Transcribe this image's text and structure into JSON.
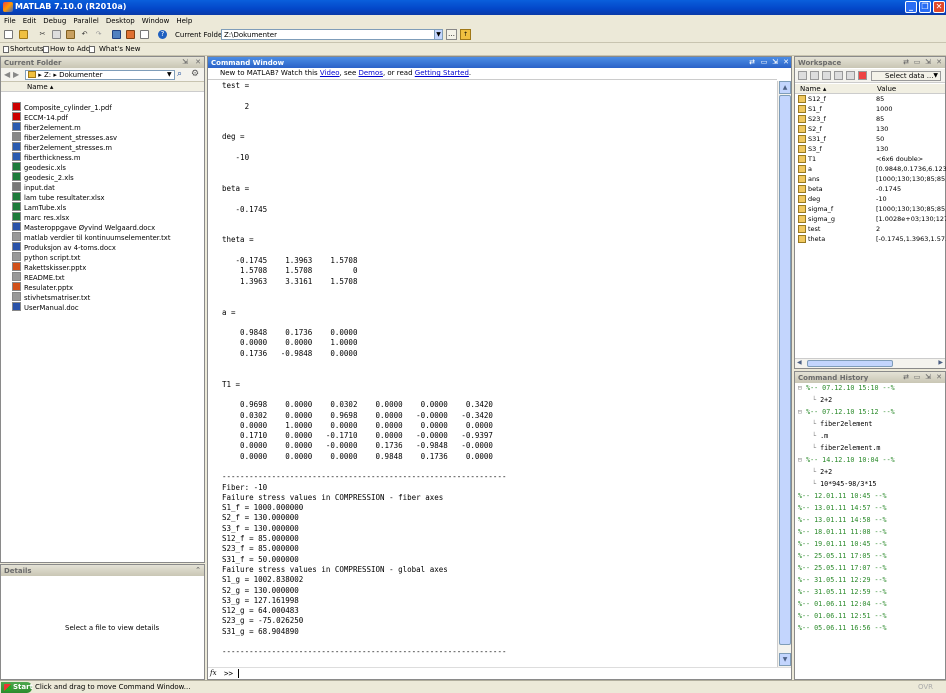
{
  "window": {
    "title": "MATLAB  7.10.0 (R2010a)"
  },
  "menu": [
    "File",
    "Edit",
    "Debug",
    "Parallel",
    "Desktop",
    "Window",
    "Help"
  ],
  "toolbar": {
    "current_folder_label": "Current Folder:",
    "current_folder_value": "Z:\\Dokumenter"
  },
  "shortcuts": {
    "shortcuts": "Shortcuts",
    "how_to_add": "How to Add",
    "whats_new": "What's New"
  },
  "current_folder_panel": {
    "title": "Current Folder",
    "path_drive": "Z:",
    "path_folder": "Dokumenter",
    "col_name": "Name ▴",
    "files": [
      {
        "name": "Composite_cylinder_1.pdf",
        "icon": "pdf-icon"
      },
      {
        "name": "ECCM-14.pdf",
        "icon": "pdf-icon"
      },
      {
        "name": "fiber2element.m",
        "icon": "m-file-icon"
      },
      {
        "name": "fiber2element_stresses.asv",
        "icon": "asv-file-icon"
      },
      {
        "name": "fiber2element_stresses.m",
        "icon": "m-file-icon"
      },
      {
        "name": "fiberthickness.m",
        "icon": "m-file-icon"
      },
      {
        "name": "geodesic.xls",
        "icon": "excel-icon"
      },
      {
        "name": "geodesic_2.xls",
        "icon": "excel-icon"
      },
      {
        "name": "input.dat",
        "icon": "dat-file-icon"
      },
      {
        "name": "lam tube resultater.xlsx",
        "icon": "excel-icon"
      },
      {
        "name": "LamTube.xls",
        "icon": "excel-icon"
      },
      {
        "name": "marc res.xlsx",
        "icon": "excel-icon"
      },
      {
        "name": "Masteroppgave Øyvind Welgaard.docx",
        "icon": "word-icon"
      },
      {
        "name": "matlab verdier til kontinuumselementer.txt",
        "icon": "text-file-icon"
      },
      {
        "name": "Produksjon av 4-toms.docx",
        "icon": "word-icon"
      },
      {
        "name": "python script.txt",
        "icon": "text-file-icon"
      },
      {
        "name": "Rakettskisser.pptx",
        "icon": "powerpoint-icon"
      },
      {
        "name": "README.txt",
        "icon": "text-file-icon"
      },
      {
        "name": "Resulater.pptx",
        "icon": "powerpoint-icon"
      },
      {
        "name": "stivhetsmatriser.txt",
        "icon": "text-file-icon"
      },
      {
        "name": "UserManual.doc",
        "icon": "word-icon"
      }
    ]
  },
  "details_panel": {
    "title": "Details",
    "message": "Select a file to view details"
  },
  "command_window": {
    "title": "Command Window",
    "banner_prefix": "New to MATLAB? Watch this ",
    "banner_video": "Video",
    "banner_mid": ", see ",
    "banner_demos": "Demos",
    "banner_or": ", or read ",
    "banner_gs": "Getting Started",
    "banner_end": ".",
    "lines": [
      "test =",
      "",
      "     2",
      "",
      "",
      "deg =",
      "",
      "   -10",
      "",
      "",
      "beta =",
      "",
      "   -0.1745",
      "",
      "",
      "theta =",
      "",
      "   -0.1745    1.3963    1.5708",
      "    1.5708    1.5708         0",
      "    1.3963    3.3161    1.5708",
      "",
      "",
      "a =",
      "",
      "    0.9848    0.1736    0.0000",
      "    0.0000    0.0000    1.0000",
      "    0.1736   -0.9848    0.0000",
      "",
      "",
      "T1 =",
      "",
      "    0.9698    0.0000    0.0302    0.0000    0.0000    0.3420",
      "    0.0302    0.0000    0.9698    0.0000   -0.0000   -0.3420",
      "    0.0000    1.0000    0.0000    0.0000    0.0000    0.0000",
      "    0.1710    0.0000   -0.1710    0.0000   -0.0000   -0.9397",
      "    0.0000    0.0000   -0.0000    0.1736   -0.9848   -0.0000",
      "    0.0000    0.0000    0.0000    0.9848    0.1736    0.0000",
      "",
      "---------------------------------------------------------------",
      "Fiber: -10",
      "Failure stress values in COMPRESSION - fiber axes",
      "S1_f = 1000.000000",
      "S2_f = 130.000000",
      "S3_f = 130.000000",
      "S12_f = 85.000000",
      "S23_f = 85.000000",
      "S31_f = 50.000000",
      "Failure stress values in COMPRESSION - global axes",
      "S1_g = 1002.838002",
      "S2_g = 130.000000",
      "S3_g = 127.161998",
      "S12_g = 64.000483",
      "S23_g = -75.026250",
      "S31_g = 68.904890",
      "",
      "---------------------------------------------------------------"
    ],
    "prompt": ">>",
    "fx": "fx"
  },
  "workspace": {
    "title": "Workspace",
    "select_data": "Select data ...",
    "col_name": "Name ▴",
    "col_value": "Value",
    "vars": [
      {
        "name": "S12_f",
        "value": "85"
      },
      {
        "name": "S1_f",
        "value": "1000"
      },
      {
        "name": "S23_f",
        "value": "85"
      },
      {
        "name": "S2_f",
        "value": "130"
      },
      {
        "name": "S31_f",
        "value": "50"
      },
      {
        "name": "S3_f",
        "value": "130"
      },
      {
        "name": "T1",
        "value": "<6x6 double>"
      },
      {
        "name": "a",
        "value": "[0.9848,0.1736,6.123..."
      },
      {
        "name": "ans",
        "value": "[1000;130;130;85;85;..."
      },
      {
        "name": "beta",
        "value": "-0.1745"
      },
      {
        "name": "deg",
        "value": "-10"
      },
      {
        "name": "sigma_f",
        "value": "[1000;130;130;85;85;..."
      },
      {
        "name": "sigma_g",
        "value": "[1.0028e+03;130;127..."
      },
      {
        "name": "test",
        "value": "2"
      },
      {
        "name": "theta",
        "value": "[-0.1745,1.3963,1.57..."
      }
    ]
  },
  "history": {
    "title": "Command History",
    "entries": [
      {
        "text": "%-- 07.12.10 15:10 --%",
        "kind": "group-open",
        "indent": 0
      },
      {
        "text": "2+2",
        "kind": "cmd",
        "indent": 1
      },
      {
        "text": "%-- 07.12.10 15:12 --%",
        "kind": "group-open",
        "indent": 0
      },
      {
        "text": "fiber2element",
        "kind": "cmd",
        "indent": 1
      },
      {
        "text": ".m",
        "kind": "cmd",
        "indent": 1
      },
      {
        "text": "fiber2element.m",
        "kind": "cmd",
        "indent": 1
      },
      {
        "text": "%-- 14.12.10 10:04 --%",
        "kind": "group-open",
        "indent": 0
      },
      {
        "text": "2+2",
        "kind": "cmd",
        "indent": 1
      },
      {
        "text": "10*945-98/3*15",
        "kind": "cmd",
        "indent": 1
      },
      {
        "text": "%-- 12.01.11 10:45 --%",
        "kind": "group",
        "indent": 0
      },
      {
        "text": "%-- 13.01.11 14:57 --%",
        "kind": "group",
        "indent": 0
      },
      {
        "text": "%-- 13.01.11 14:58 --%",
        "kind": "group",
        "indent": 0
      },
      {
        "text": "%-- 18.01.11 11:08 --%",
        "kind": "group",
        "indent": 0
      },
      {
        "text": "%-- 19.01.11 10:45 --%",
        "kind": "group",
        "indent": 0
      },
      {
        "text": "%-- 25.05.11 17:05 --%",
        "kind": "group",
        "indent": 0
      },
      {
        "text": "%-- 25.05.11 17:07 --%",
        "kind": "group",
        "indent": 0
      },
      {
        "text": "%-- 31.05.11 12:29 --%",
        "kind": "group",
        "indent": 0
      },
      {
        "text": "%-- 31.05.11 12:59 --%",
        "kind": "group",
        "indent": 0
      },
      {
        "text": "%-- 01.06.11 12:04 --%",
        "kind": "group",
        "indent": 0
      },
      {
        "text": "%-- 01.06.11 12:51 --%",
        "kind": "group",
        "indent": 0
      },
      {
        "text": "%-- 05.06.11 16:56 --%",
        "kind": "group",
        "indent": 0
      }
    ]
  },
  "status": {
    "start": "Start",
    "message": "Click and drag to move Command Window...",
    "ovr": "OVR"
  }
}
